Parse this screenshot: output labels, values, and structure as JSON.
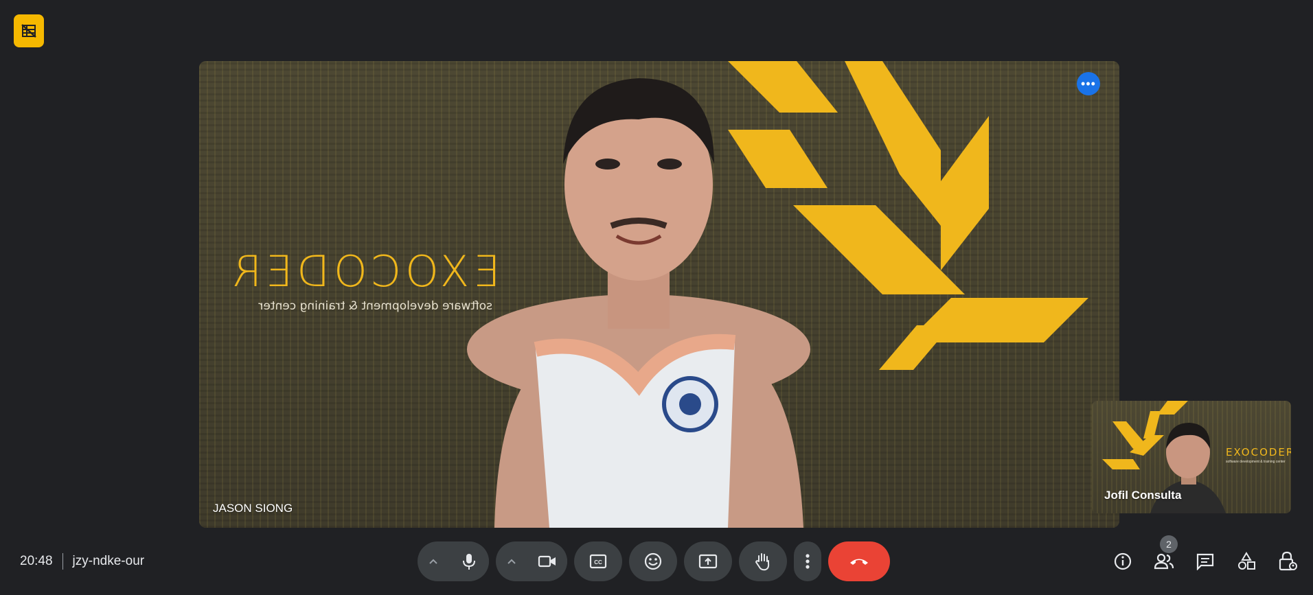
{
  "colors": {
    "background": "#202124",
    "accent_yellow": "#f5b800",
    "control_gray": "#3c4043",
    "end_call_red": "#ea4335",
    "blue": "#1a73e8"
  },
  "top_badge": {
    "icon": "no-video-grid-icon"
  },
  "main_tile": {
    "participant_name": "JASON SIONG",
    "brand_word": "EXOCODER",
    "brand_sub": "software development & training center",
    "more_label": "•••"
  },
  "self_tile": {
    "participant_name": "Jofil Consulta",
    "brand_word": "EXOCODER",
    "brand_sub": "software development & training center"
  },
  "meeting": {
    "time": "20:48",
    "code": "jzy-ndke-our"
  },
  "controls": {
    "mic_icon": "microphone-icon",
    "camera_icon": "video-camera-icon",
    "captions_icon": "closed-captions-icon",
    "emoji_icon": "emoji-icon",
    "present_icon": "present-screen-icon",
    "hand_icon": "raise-hand-icon",
    "more_icon": "more-vertical-icon",
    "end_icon": "end-call-icon",
    "arrow_glyph": "^"
  },
  "right_tools": {
    "people_count": "2"
  }
}
